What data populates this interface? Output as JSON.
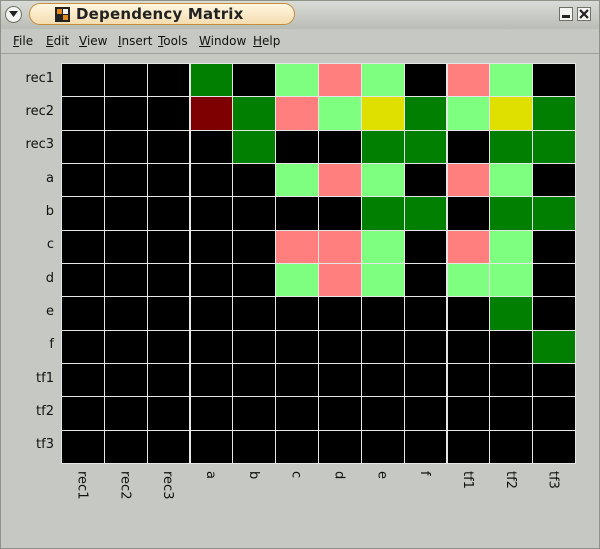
{
  "window": {
    "title": "Dependency Matrix"
  },
  "menubar": {
    "items": [
      {
        "label": "File",
        "key": "F",
        "rest": "ile"
      },
      {
        "label": "Edit",
        "key": "E",
        "rest": "dit"
      },
      {
        "label": "View",
        "key": "V",
        "rest": "iew"
      },
      {
        "label": "Insert",
        "key": "I",
        "rest": "nsert"
      },
      {
        "label": "Tools",
        "key": "T",
        "rest": "ools"
      },
      {
        "label": "Window",
        "key": "W",
        "rest": "indow"
      },
      {
        "label": "Help",
        "key": "H",
        "rest": "elp"
      }
    ]
  },
  "matrix": {
    "rows": [
      "rec1",
      "rec2",
      "rec3",
      "a",
      "b",
      "c",
      "d",
      "e",
      "f",
      "tf1",
      "tf2",
      "tf3"
    ],
    "cols": [
      "rec1",
      "rec2",
      "rec3",
      "a",
      "b",
      "c",
      "d",
      "e",
      "f",
      "tf1",
      "tf2",
      "tf3"
    ],
    "palette": {
      "K": "#000000",
      "G": "#007f00",
      "L": "#7fff7f",
      "P": "#ff7f7f",
      "R": "#7f0000",
      "Y": "#dfdf00"
    },
    "cells": [
      [
        "K",
        "K",
        "K",
        "G",
        "K",
        "L",
        "P",
        "L",
        "K",
        "P",
        "L",
        "K"
      ],
      [
        "K",
        "K",
        "K",
        "R",
        "G",
        "P",
        "L",
        "Y",
        "G",
        "L",
        "Y",
        "G"
      ],
      [
        "K",
        "K",
        "K",
        "K",
        "G",
        "K",
        "K",
        "G",
        "G",
        "K",
        "G",
        "G"
      ],
      [
        "K",
        "K",
        "K",
        "K",
        "K",
        "L",
        "P",
        "L",
        "K",
        "P",
        "L",
        "K"
      ],
      [
        "K",
        "K",
        "K",
        "K",
        "K",
        "K",
        "K",
        "G",
        "G",
        "K",
        "G",
        "G"
      ],
      [
        "K",
        "K",
        "K",
        "K",
        "K",
        "P",
        "P",
        "L",
        "K",
        "P",
        "L",
        "K"
      ],
      [
        "K",
        "K",
        "K",
        "K",
        "K",
        "L",
        "P",
        "L",
        "K",
        "L",
        "L",
        "K"
      ],
      [
        "K",
        "K",
        "K",
        "K",
        "K",
        "K",
        "K",
        "K",
        "K",
        "K",
        "G",
        "K"
      ],
      [
        "K",
        "K",
        "K",
        "K",
        "K",
        "K",
        "K",
        "K",
        "K",
        "K",
        "K",
        "G"
      ],
      [
        "K",
        "K",
        "K",
        "K",
        "K",
        "K",
        "K",
        "K",
        "K",
        "K",
        "K",
        "K"
      ],
      [
        "K",
        "K",
        "K",
        "K",
        "K",
        "K",
        "K",
        "K",
        "K",
        "K",
        "K",
        "K"
      ],
      [
        "K",
        "K",
        "K",
        "K",
        "K",
        "K",
        "K",
        "K",
        "K",
        "K",
        "K",
        "K"
      ]
    ]
  }
}
